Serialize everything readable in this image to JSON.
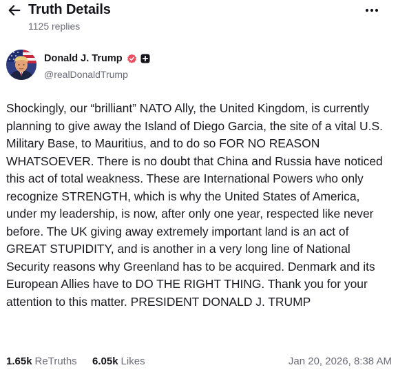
{
  "header": {
    "title": "Truth Details",
    "replies": "1125 replies",
    "back_icon": "arrow-left-icon",
    "more_icon": "ellipsis-icon"
  },
  "author": {
    "name": "Donald J. Trump",
    "handle": "@realDonaldTrump",
    "verified_color": "#ed4f62"
  },
  "post": {
    "text": "Shockingly, our “brilliant” NATO Ally, the United Kingdom, is currently planning to give away the Island of Diego Garcia, the site of a vital U.S. Military Base, to Mauritius, and to do so FOR NO REASON WHATSOEVER. There is no doubt that China and Russia have noticed this act of total weakness. These are International Powers who only recognize STRENGTH, which is why the United States of America, under my leadership, is now, after only one year, respected like never before. The UK giving away extremely important land is an act of GREAT STUPIDITY, and is another in a very long line of National Security reasons why Greenland has to be acquired. Denmark and its European Allies have to DO THE RIGHT THING. Thank you for your attention to this matter. PRESIDENT DONALD J. TRUMP"
  },
  "stats": {
    "retruths_count": "1.65k",
    "retruths_label": "ReTruths",
    "likes_count": "6.05k",
    "likes_label": "Likes",
    "timestamp": "Jan 20, 2026, 8:38 AM"
  }
}
